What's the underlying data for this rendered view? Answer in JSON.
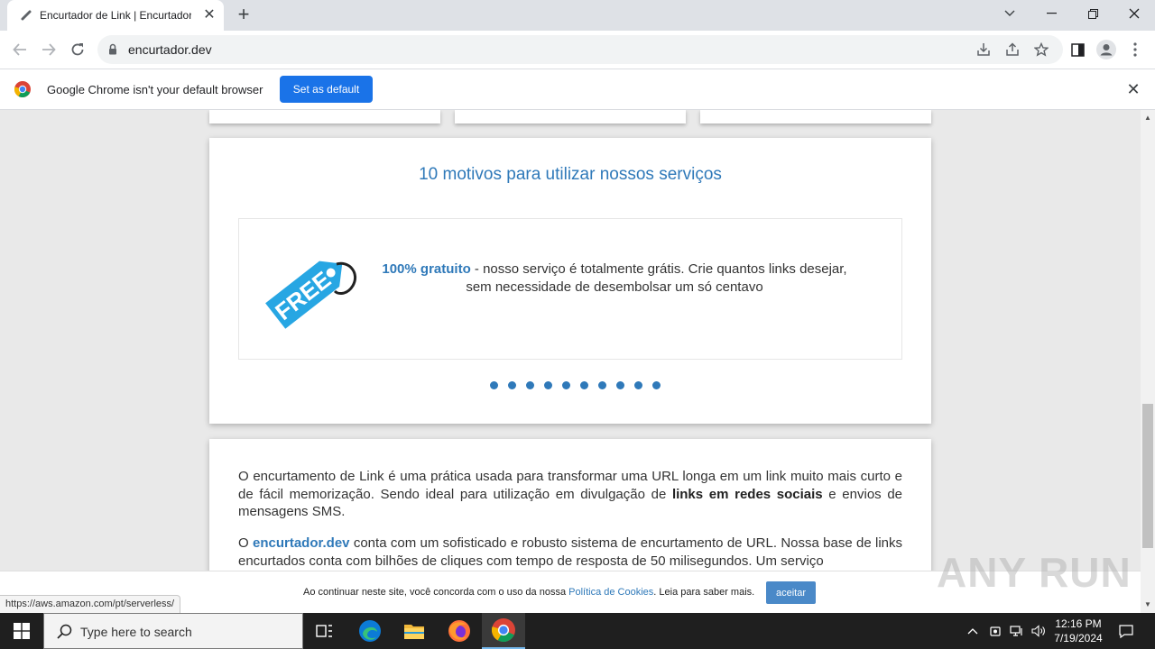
{
  "browser": {
    "tab_title": "Encurtador de Link | Encurtador",
    "tab_close": "✕",
    "new_tab": "+",
    "url": "encurtador.dev",
    "infobar_text": "Google Chrome isn't your default browser",
    "set_default_label": "Set as default",
    "infobar_close": "✕",
    "status_url": "https://aws.amazon.com/pt/serverless/",
    "accent_color": "#1a73e8"
  },
  "page": {
    "motivos_title": "10 motivos para utilizar nossos serviços",
    "slide": {
      "tag_text": "FREE",
      "strong": "100% gratuito",
      "text_line1": " - nosso serviço é totalmente grátis. Crie quantos links desejar,",
      "text_line2": "sem necessidade de desembolsar um só centavo"
    },
    "dots_count": 10,
    "para1": {
      "a": "O encurtamento de Link é uma prática usada para transformar uma URL longa em um link muito mais curto e de fácil memorização. Sendo ideal para utilização em divulgação de ",
      "b": "links em redes sociais",
      "c": " e envios de mensagens SMS."
    },
    "para2": {
      "a": "O ",
      "brand": "encurtador.dev",
      "b": " conta com um sofisticado e robusto sistema de encurtamento de URL. Nossa base de links encurtados conta com bilhões de cliques com tempo de resposta de 50 milisegundos. Um serviço"
    },
    "brand_color": "#2f79b9",
    "cookie": {
      "text_before": "Ao continuar neste site, você concorda com o uso da nossa ",
      "link": "Política de Cookies",
      "text_after": ". Leia para saber mais.",
      "accept": "aceitar"
    }
  },
  "watermark": "ANY RUN",
  "taskbar": {
    "search_placeholder": "Type here to search",
    "time": "12:16 PM",
    "date": "7/19/2024"
  }
}
